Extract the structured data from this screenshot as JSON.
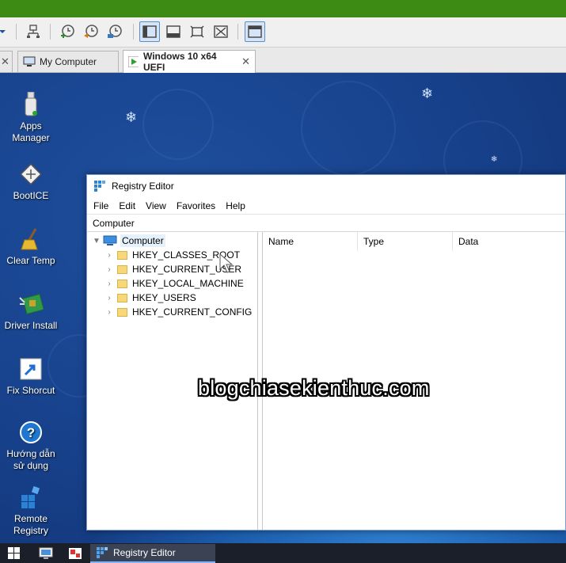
{
  "host": {
    "tabs": [
      {
        "label": "My Computer",
        "active": false
      },
      {
        "label": "Windows 10 x64 UEFI",
        "active": true
      }
    ]
  },
  "desktop": {
    "icons": [
      {
        "label": "Apps\nManager",
        "icon": "usb-drive-icon"
      },
      {
        "label": "BootICE",
        "icon": "bootice-icon"
      },
      {
        "label": "Clear Temp",
        "icon": "broom-icon"
      },
      {
        "label": "Driver Install",
        "icon": "driver-board-icon"
      },
      {
        "label": "Fix Shorcut",
        "icon": "shortcut-arrow-icon"
      },
      {
        "label": "Hướng dẫn\nsử dụng",
        "icon": "help-icon"
      },
      {
        "label": "Remote\nRegistry",
        "icon": "registry-cubes-icon"
      }
    ]
  },
  "registry": {
    "title": "Registry Editor",
    "menu": [
      "File",
      "Edit",
      "View",
      "Favorites",
      "Help"
    ],
    "address": "Computer",
    "tree": {
      "root": "Computer",
      "children": [
        "HKEY_CLASSES_ROOT",
        "HKEY_CURRENT_USER",
        "HKEY_LOCAL_MACHINE",
        "HKEY_USERS",
        "HKEY_CURRENT_CONFIG"
      ]
    },
    "columns": [
      "Name",
      "Type",
      "Data"
    ]
  },
  "watermark": "blogchiasekienthuc.com",
  "taskbar": {
    "app_label": "Registry Editor"
  },
  "colors": {
    "host_green": "#3d8b14",
    "desktop_blue": "#163f88",
    "accent": "#5b8ccc"
  }
}
